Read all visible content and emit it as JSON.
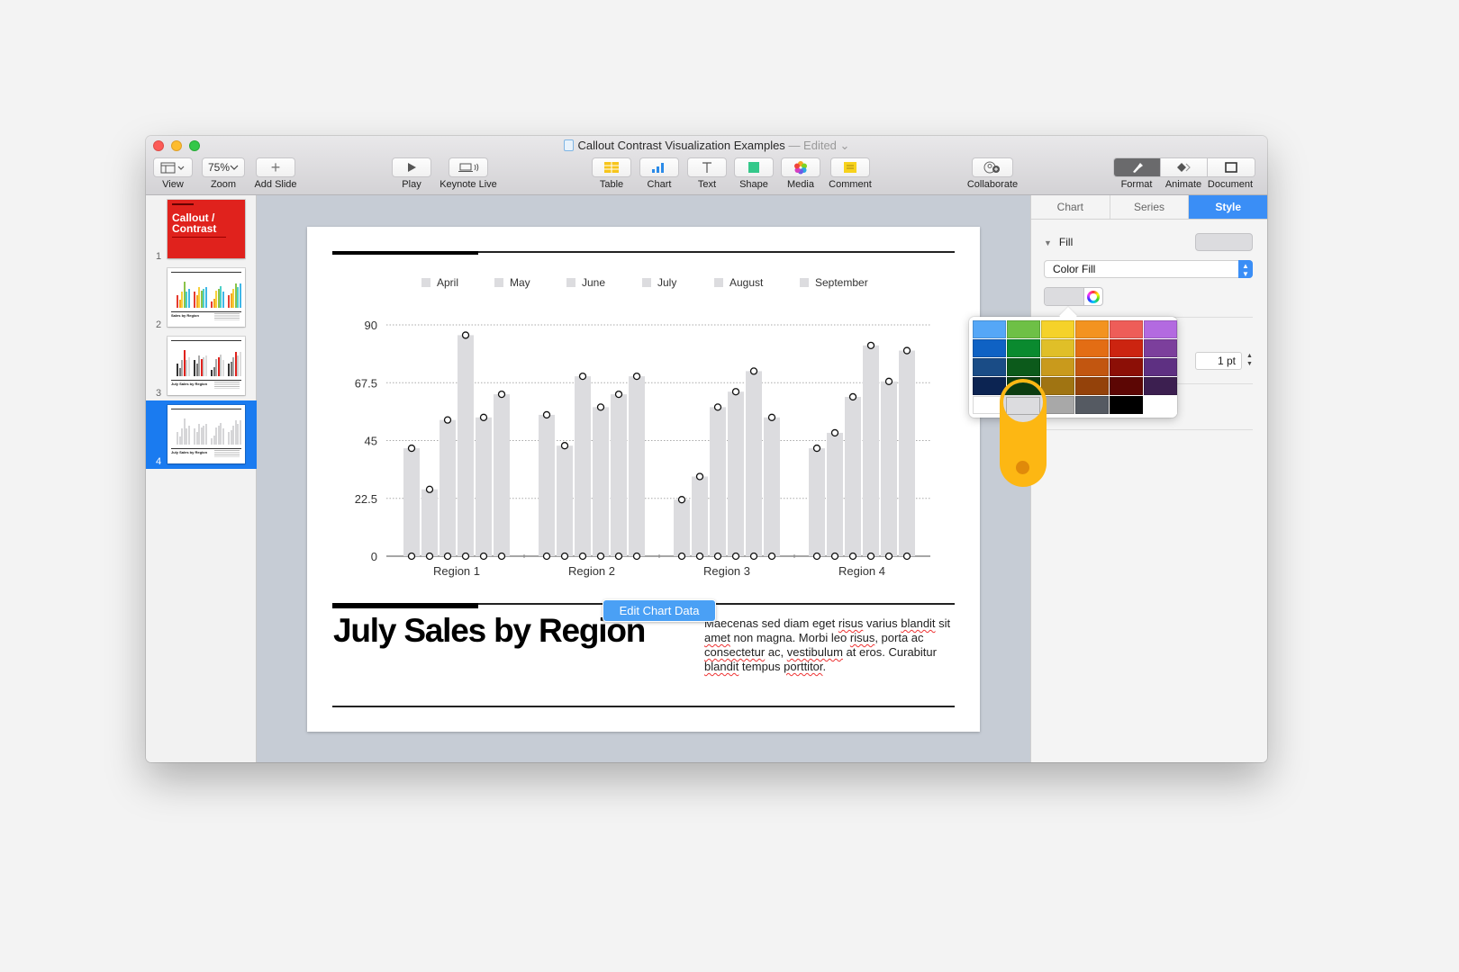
{
  "window": {
    "title": "Callout Contrast Visualization Examples",
    "status": "— Edited",
    "status_chevron": "⌄"
  },
  "toolbar": {
    "view": "View",
    "zoom": "Zoom",
    "zoom_value": "75%",
    "add_slide": "Add Slide",
    "play": "Play",
    "keynote_live": "Keynote Live",
    "table": "Table",
    "chart": "Chart",
    "text": "Text",
    "shape": "Shape",
    "media": "Media",
    "comment": "Comment",
    "collaborate": "Collaborate",
    "format": "Format",
    "animate": "Animate",
    "document": "Document"
  },
  "navigator": {
    "slides": [
      {
        "number": "1",
        "title": "Callout / Contrast"
      },
      {
        "number": "2",
        "title": "Sales by Region"
      },
      {
        "number": "3",
        "title": "July Sales by Region"
      },
      {
        "number": "4",
        "title": "July Sales by Region",
        "selected": true
      }
    ]
  },
  "slide": {
    "title": "July Sales by Region",
    "body_parts": [
      "Maecenas sed diam eget ",
      "risus",
      " varius ",
      "blandit",
      " sit ",
      "amet",
      " non magna. Morbi leo ",
      "risus",
      ", porta ac ",
      "consectetur",
      " ac, ",
      "vestibulum",
      " at eros. Curabitur ",
      "blandit",
      " tempus ",
      "porttitor",
      "."
    ],
    "edit_chart_button": "Edit Chart Data"
  },
  "chart_data": {
    "type": "bar",
    "title": "",
    "xlabel": "",
    "ylabel": "",
    "categories": [
      "Region 1",
      "Region 2",
      "Region 3",
      "Region 4"
    ],
    "series": [
      {
        "name": "April",
        "values": [
          42,
          55,
          22,
          42
        ]
      },
      {
        "name": "May",
        "values": [
          26,
          43,
          31,
          48
        ]
      },
      {
        "name": "June",
        "values": [
          53,
          70,
          58,
          62
        ]
      },
      {
        "name": "July",
        "values": [
          86,
          58,
          64,
          82
        ]
      },
      {
        "name": "August",
        "values": [
          54,
          63,
          72,
          68
        ]
      },
      {
        "name": "September",
        "values": [
          63,
          70,
          54,
          80
        ]
      }
    ],
    "ylim": [
      0,
      90
    ],
    "yticks": [
      0,
      22.5,
      45,
      67.5,
      90
    ],
    "ytick_labels": [
      "0",
      "22.5",
      "45",
      "67.5",
      "90"
    ],
    "grid": true,
    "legend": "top",
    "bar_color": "#dcdcdf"
  },
  "inspector": {
    "tabs": [
      "Chart",
      "Series",
      "Style"
    ],
    "active_tab": "Style",
    "fill_label": "Fill",
    "fill_type": "Color Fill",
    "stroke_width": "1 pt",
    "accent": "#3a8ef6"
  },
  "color_palette": [
    "#55a7f7",
    "#6ec046",
    "#f5d22a",
    "#f39320",
    "#ee5d58",
    "#b36ae0",
    "#0f62c4",
    "#0a8a2f",
    "#e0bf28",
    "#e36d14",
    "#cc2410",
    "#7c3f9c",
    "#1a4c86",
    "#0c5a1b",
    "#c99a1c",
    "#c25610",
    "#8c0f06",
    "#5e3082",
    "#0c2452",
    "#0c3c10",
    "#a07412",
    "#94420a",
    "#5c0604",
    "#3c1f50",
    "#ffffff",
    "#dcdcdf",
    "#a8a8a8",
    "#555a62",
    "#000000"
  ]
}
